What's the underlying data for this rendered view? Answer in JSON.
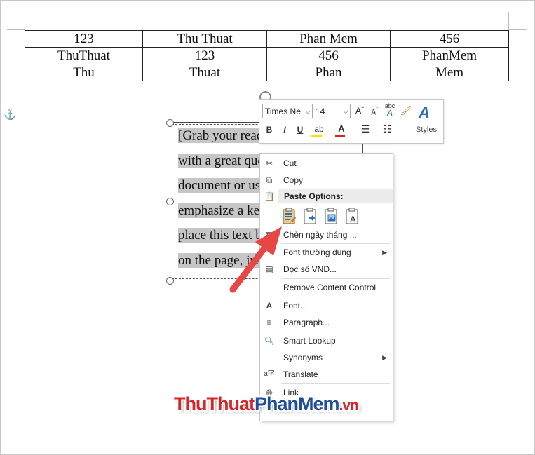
{
  "table": {
    "rows": [
      [
        "123",
        "Thu Thuat",
        "Phan Mem",
        "456"
      ],
      [
        "ThuThuat",
        "123",
        "456",
        "PhanMem"
      ],
      [
        "Thu",
        "Thuat",
        "Phan",
        "Mem"
      ]
    ]
  },
  "textbox": {
    "lines": [
      "[Grab your reader's attention",
      "with a great quote from the",
      "document or use this space to",
      "emphasize a key point. To",
      "place this text box anywhere",
      "on the page, just drag it.]"
    ]
  },
  "mini_toolbar": {
    "font_name": "Times Ne",
    "font_size": "14",
    "styles_label": "Styles",
    "grow_font": "A",
    "shrink_font": "A",
    "bold": "B",
    "italic": "I",
    "underline": "U",
    "font_color_letter": "A"
  },
  "context_menu": {
    "cut": "Cut",
    "copy": "Copy",
    "paste_options_header": "Paste Options:",
    "insert_date": "Chèn ngày tháng ...",
    "common_fonts": "Font thường dùng",
    "read_vnd": "Đọc số VNĐ...",
    "remove_content_control": "Remove Content Control",
    "font": "Font...",
    "paragraph": "Paragraph...",
    "smart_lookup": "Smart Lookup",
    "synonyms": "Synonyms",
    "translate": "Translate",
    "link": "Link"
  },
  "watermark": {
    "part1": "ThuThuat",
    "part2": "PhanMem",
    "part3": ".vn"
  },
  "colors": {
    "arrow": "#e84545",
    "highlight": "#c6c6c6",
    "watermark_red": "#d4252a",
    "watermark_blue": "#1f4f9a",
    "icon_blue": "#2e6fb5"
  }
}
